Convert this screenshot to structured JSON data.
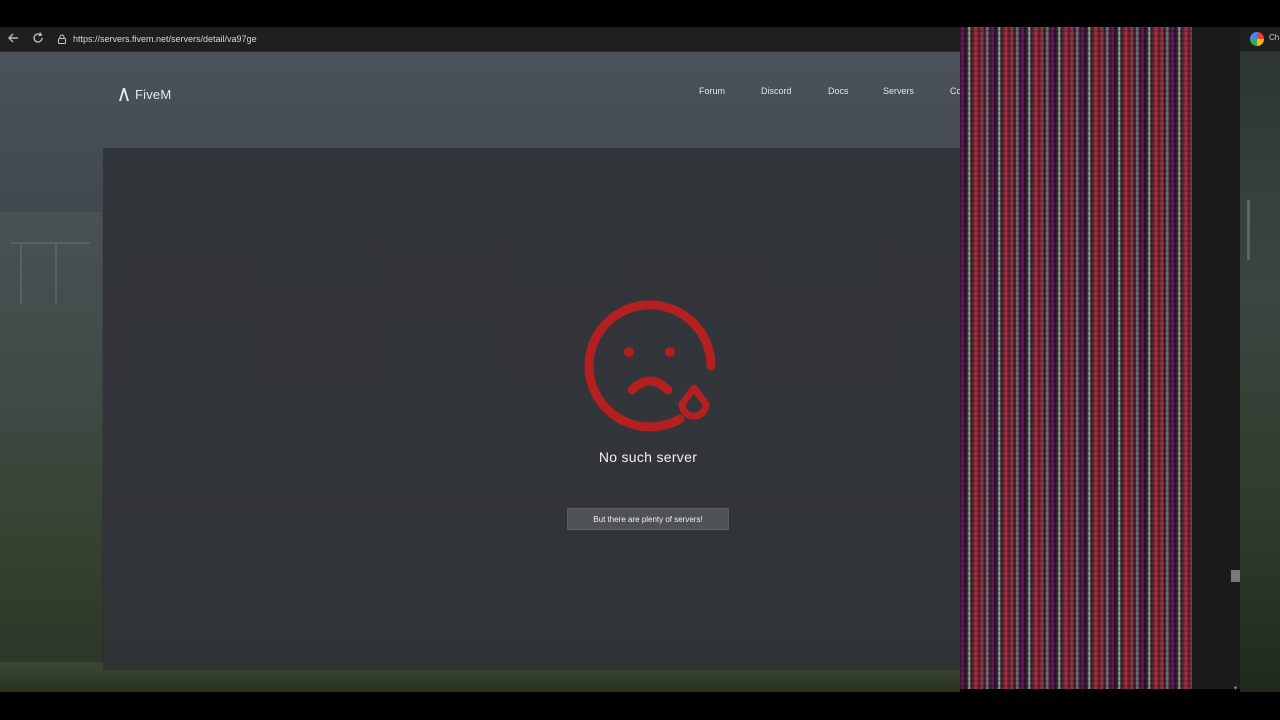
{
  "browser": {
    "url": "https://servers.fivem.net/servers/detail/va97ge"
  },
  "site": {
    "logo_text": "FiveM",
    "nav": [
      "Forum",
      "Discord",
      "Docs",
      "Servers",
      "Co"
    ]
  },
  "error": {
    "title": "No such server",
    "button_label": "But there are plenty of servers!",
    "icon_color": "#b3201f"
  },
  "side_window": {
    "tab_label": "Ch"
  }
}
